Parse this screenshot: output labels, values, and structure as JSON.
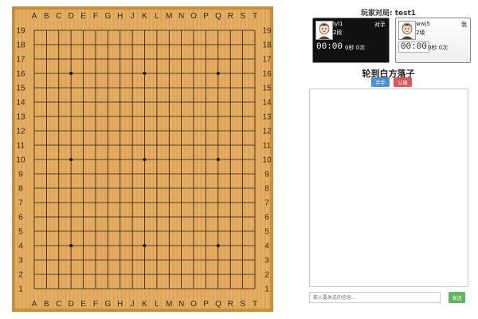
{
  "board": {
    "size": 19,
    "columns": [
      "A",
      "B",
      "C",
      "D",
      "E",
      "F",
      "G",
      "H",
      "J",
      "K",
      "L",
      "M",
      "N",
      "O",
      "P",
      "Q",
      "R",
      "S",
      "T"
    ],
    "rows": [
      "19",
      "18",
      "17",
      "16",
      "15",
      "14",
      "13",
      "12",
      "11",
      "10",
      "9",
      "8",
      "7",
      "6",
      "5",
      "4",
      "3",
      "2",
      "1"
    ],
    "star_points": [
      "D16",
      "K16",
      "Q16",
      "D10",
      "K10",
      "Q10",
      "D4",
      "K4",
      "Q4"
    ],
    "colors": {
      "frame": "#c98f3a",
      "surface": "#e2a95a",
      "lines": "#2b1e10"
    }
  },
  "panel": {
    "title": "玩家对局: test1",
    "turn_text": "轮到白方落子",
    "pass_label": "弃手",
    "resign_label": "认输"
  },
  "players": {
    "black": {
      "name": "lyl1",
      "rank": "2段",
      "role": "对手",
      "time": "00:00",
      "byoyomi": "0秒 0次"
    },
    "white": {
      "name": "wwj5",
      "rank": "2级",
      "role": "我",
      "time": "00:00",
      "byoyomi": "0秒 0次"
    }
  },
  "chat": {
    "input_placeholder": "输入要发送的信息...",
    "send_label": "发送"
  }
}
